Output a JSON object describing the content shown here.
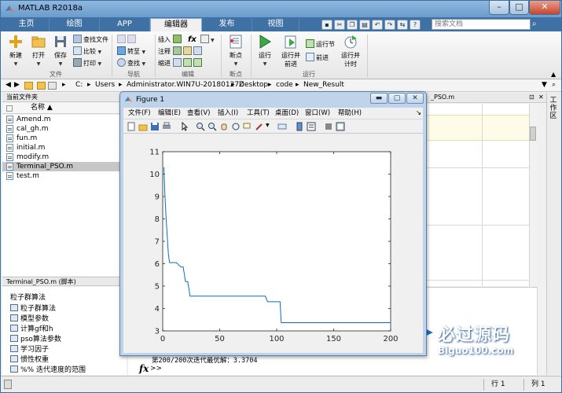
{
  "app": {
    "title": "MATLAB R2018a"
  },
  "window_controls": {
    "minimize": "–",
    "maximize": "□",
    "close": "✕"
  },
  "tabs": [
    {
      "label": "主页",
      "active": false
    },
    {
      "label": "绘图",
      "active": false
    },
    {
      "label": "APP",
      "active": false
    },
    {
      "label": "编辑器",
      "active": true
    },
    {
      "label": "发布",
      "active": false
    },
    {
      "label": "视图",
      "active": false
    }
  ],
  "search": {
    "placeholder": "搜索文档"
  },
  "ribbon": {
    "file_group": {
      "label": "文件",
      "new": "新建",
      "open": "打开",
      "save": "保存",
      "find_files": "查找文件",
      "compare": "比较",
      "print": "打印"
    },
    "nav_group": {
      "label": "导航",
      "goto": "转至",
      "find": "查找"
    },
    "edit_group": {
      "label": "编辑",
      "insert": "插入",
      "comment": "注释",
      "indent": "缩进",
      "fx": "fx"
    },
    "breakpoint_group": {
      "label": "断点",
      "breakpoint": "断点"
    },
    "run_group": {
      "label": "运行",
      "run": "运行",
      "run_advance_1": "运行并",
      "run_advance_2": "前进",
      "run_section": "运行节",
      "advance": "前进",
      "run_time_1": "运行并",
      "run_time_2": "计时"
    }
  },
  "address": {
    "parts": [
      "C:",
      "Users",
      "Administrator.WIN7U-20180127Z",
      "Desktop",
      "code",
      "New_Result"
    ]
  },
  "current_folder": {
    "header": "当前文件夹",
    "column": "名称 ▲",
    "files": [
      {
        "name": "Amend.m",
        "selected": false
      },
      {
        "name": "cal_gh.m",
        "selected": false
      },
      {
        "name": "fun.m",
        "selected": false
      },
      {
        "name": "initial.m",
        "selected": false
      },
      {
        "name": "modify.m",
        "selected": false
      },
      {
        "name": "Terminal_PSO.m",
        "selected": true
      },
      {
        "name": "test.m",
        "selected": false
      }
    ]
  },
  "details": {
    "header": "Terminal_PSO.m  (脚本)",
    "title": "粒子群算法",
    "sections": [
      "粒子群算法",
      "模型参数",
      "计算gf和h",
      "pso算法参数",
      "学习因子",
      "惯性权重",
      "%% 迭代速度的范围"
    ]
  },
  "editor": {
    "tab_fragment": "_PSO.m"
  },
  "workspace_label": "工作区",
  "command_window": {
    "output": "第200/200次迭代最优解：3.3704",
    "prompt_fx": "fx",
    "prompt": ">>"
  },
  "status": {
    "row": "行 1",
    "col": "列 1"
  },
  "watermark": {
    "cn": "必过源码",
    "en": "Biguo100.com"
  },
  "figure": {
    "title": "Figure 1",
    "controls": {
      "minimize": "▬",
      "maximize": "▢",
      "close": "✕"
    },
    "menus": [
      "文件(F)",
      "编辑(E)",
      "查看(V)",
      "插入(I)",
      "工具(T)",
      "桌面(D)",
      "窗口(W)",
      "帮助(H)"
    ],
    "menu_arrow": "↘"
  },
  "chart_data": {
    "type": "line",
    "title": "",
    "xlabel": "",
    "ylabel": "",
    "xlim": [
      0,
      200
    ],
    "ylim": [
      3,
      11
    ],
    "xticks": [
      0,
      50,
      100,
      150,
      200
    ],
    "yticks": [
      3,
      4,
      5,
      6,
      7,
      8,
      9,
      10,
      11
    ],
    "color": "#0072bd",
    "series": [
      {
        "x": [
          1,
          2,
          3,
          4,
          5,
          6,
          8,
          10,
          12,
          16,
          18,
          20,
          22,
          24,
          26,
          28,
          30,
          35,
          40,
          50,
          60,
          70,
          80,
          90,
          92,
          95,
          100,
          103,
          104,
          110,
          130,
          150,
          170,
          190,
          200
        ],
        "y": [
          10.3,
          9.0,
          8.0,
          7.2,
          6.4,
          6.05,
          6.05,
          6.05,
          6.05,
          5.85,
          5.85,
          5.2,
          5.2,
          4.55,
          4.55,
          4.55,
          4.55,
          4.55,
          4.55,
          4.55,
          4.55,
          4.55,
          4.55,
          4.55,
          4.3,
          4.3,
          4.3,
          4.3,
          3.37,
          3.37,
          3.37,
          3.37,
          3.37,
          3.37,
          3.37
        ]
      }
    ]
  }
}
